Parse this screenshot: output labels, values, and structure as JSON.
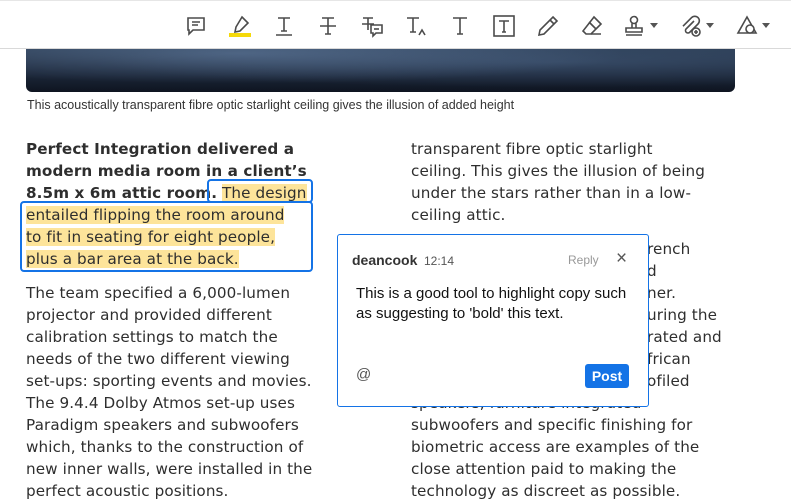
{
  "toolbar": {
    "tools": [
      {
        "name": "comment-icon"
      },
      {
        "name": "highlight-icon"
      },
      {
        "name": "underline-icon"
      },
      {
        "name": "strikethrough-icon"
      },
      {
        "name": "replace-text-icon"
      },
      {
        "name": "insert-text-icon"
      },
      {
        "name": "add-text-icon"
      },
      {
        "name": "text-box-icon"
      },
      {
        "name": "pencil-icon"
      },
      {
        "name": "eraser-icon"
      },
      {
        "name": "stamp-icon"
      },
      {
        "name": "attach-file-icon"
      },
      {
        "name": "shapes-icon"
      }
    ],
    "accent": "#1473e6",
    "highlight_color": "#fde49a"
  },
  "caption": "This acoustically transparent fibre optic starlight ceiling gives the illusion of added height",
  "left_column": {
    "p1_bold_lines": [
      "Perfect Integration delivered a",
      "modern media room in a client’s",
      "8.5m x 6m attic room."
    ],
    "p1_highlight_lines": [
      "The design",
      "entailed flipping the room around",
      "to fit in seating for eight people,",
      "plus a bar area at the back."
    ],
    "p2_lines": [
      "The team specified a 6,000-lumen",
      "projector and provided different",
      "calibration settings to match the",
      "needs of the two different viewing",
      "set-ups: sporting events and movies.",
      "The 9.4.4 Dolby Atmos set-up uses",
      "Paradigm speakers and subwoofers",
      "which, thanks to the construction of",
      "new inner walls, were installed in the",
      "perfect acoustic positions."
    ]
  },
  "right_column": {
    "lines": [
      "transparent fibre optic starlight",
      "ceiling. This gives the illusion of being",
      "under the stars rather than in a low-",
      "ceiling attic.",
      "",
      "rench",
      "d",
      "ner.",
      "uring the",
      "rated and",
      "frican",
      "ofiled",
      "speakers, furniture integrated",
      "subwoofers and specific finishing for",
      "biometric access are examples of the",
      "close attention paid to making the",
      "technology as discreet as possible."
    ]
  },
  "comment": {
    "author": "deancook",
    "time": "12:14",
    "reply_label": "Reply",
    "close_glyph": "×",
    "body": "This is a good tool to highlight copy such as suggesting to 'bold' this text.",
    "mention_glyph": "@",
    "post_label": "Post"
  }
}
